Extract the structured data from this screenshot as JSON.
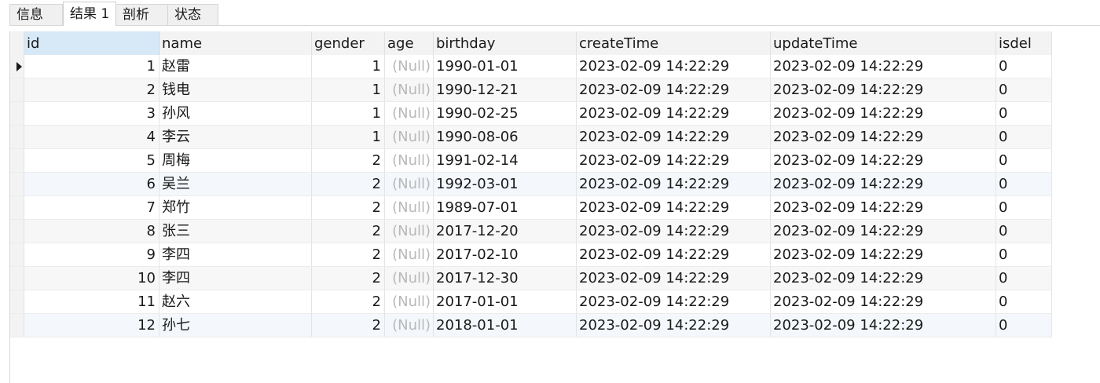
{
  "tabs": [
    {
      "label": "信息",
      "active": false
    },
    {
      "label": "结果 1",
      "active": true
    },
    {
      "label": "剖析",
      "active": false
    },
    {
      "label": "状态",
      "active": false
    }
  ],
  "grid": {
    "columns": [
      "id",
      "name",
      "gender",
      "age",
      "birthday",
      "createTime",
      "updateTime",
      "isdel"
    ],
    "selected_column": "id",
    "rows": [
      [
        "1",
        "赵雷",
        "1",
        "(Null)",
        "1990-01-01",
        "2023-02-09 14:22:29",
        "2023-02-09 14:22:29",
        "0"
      ],
      [
        "2",
        "钱电",
        "1",
        "(Null)",
        "1990-12-21",
        "2023-02-09 14:22:29",
        "2023-02-09 14:22:29",
        "0"
      ],
      [
        "3",
        "孙风",
        "1",
        "(Null)",
        "1990-02-25",
        "2023-02-09 14:22:29",
        "2023-02-09 14:22:29",
        "0"
      ],
      [
        "4",
        "李云",
        "1",
        "(Null)",
        "1990-08-06",
        "2023-02-09 14:22:29",
        "2023-02-09 14:22:29",
        "0"
      ],
      [
        "5",
        "周梅",
        "2",
        "(Null)",
        "1991-02-14",
        "2023-02-09 14:22:29",
        "2023-02-09 14:22:29",
        "0"
      ],
      [
        "6",
        "吴兰",
        "2",
        "(Null)",
        "1992-03-01",
        "2023-02-09 14:22:29",
        "2023-02-09 14:22:29",
        "0"
      ],
      [
        "7",
        "郑竹",
        "2",
        "(Null)",
        "1989-07-01",
        "2023-02-09 14:22:29",
        "2023-02-09 14:22:29",
        "0"
      ],
      [
        "8",
        "张三",
        "2",
        "(Null)",
        "2017-12-20",
        "2023-02-09 14:22:29",
        "2023-02-09 14:22:29",
        "0"
      ],
      [
        "9",
        "李四",
        "2",
        "(Null)",
        "2017-02-10",
        "2023-02-09 14:22:29",
        "2023-02-09 14:22:29",
        "0"
      ],
      [
        "10",
        "李四",
        "2",
        "(Null)",
        "2017-12-30",
        "2023-02-09 14:22:29",
        "2023-02-09 14:22:29",
        "0"
      ],
      [
        "11",
        "赵六",
        "2",
        "(Null)",
        "2017-01-01",
        "2023-02-09 14:22:29",
        "2023-02-09 14:22:29",
        "0"
      ],
      [
        "12",
        "孙七",
        "2",
        "(Null)",
        "2018-01-01",
        "2023-02-09 14:22:29",
        "2023-02-09 14:22:29",
        "0"
      ]
    ],
    "current_row_index": 0
  },
  "colors": {
    "selected_header": "#d7e9f7",
    "null_text": "#b8b8b8",
    "alt_row": "#f7f7f7"
  },
  "icons": {
    "current_row": "row-pointer-icon"
  }
}
